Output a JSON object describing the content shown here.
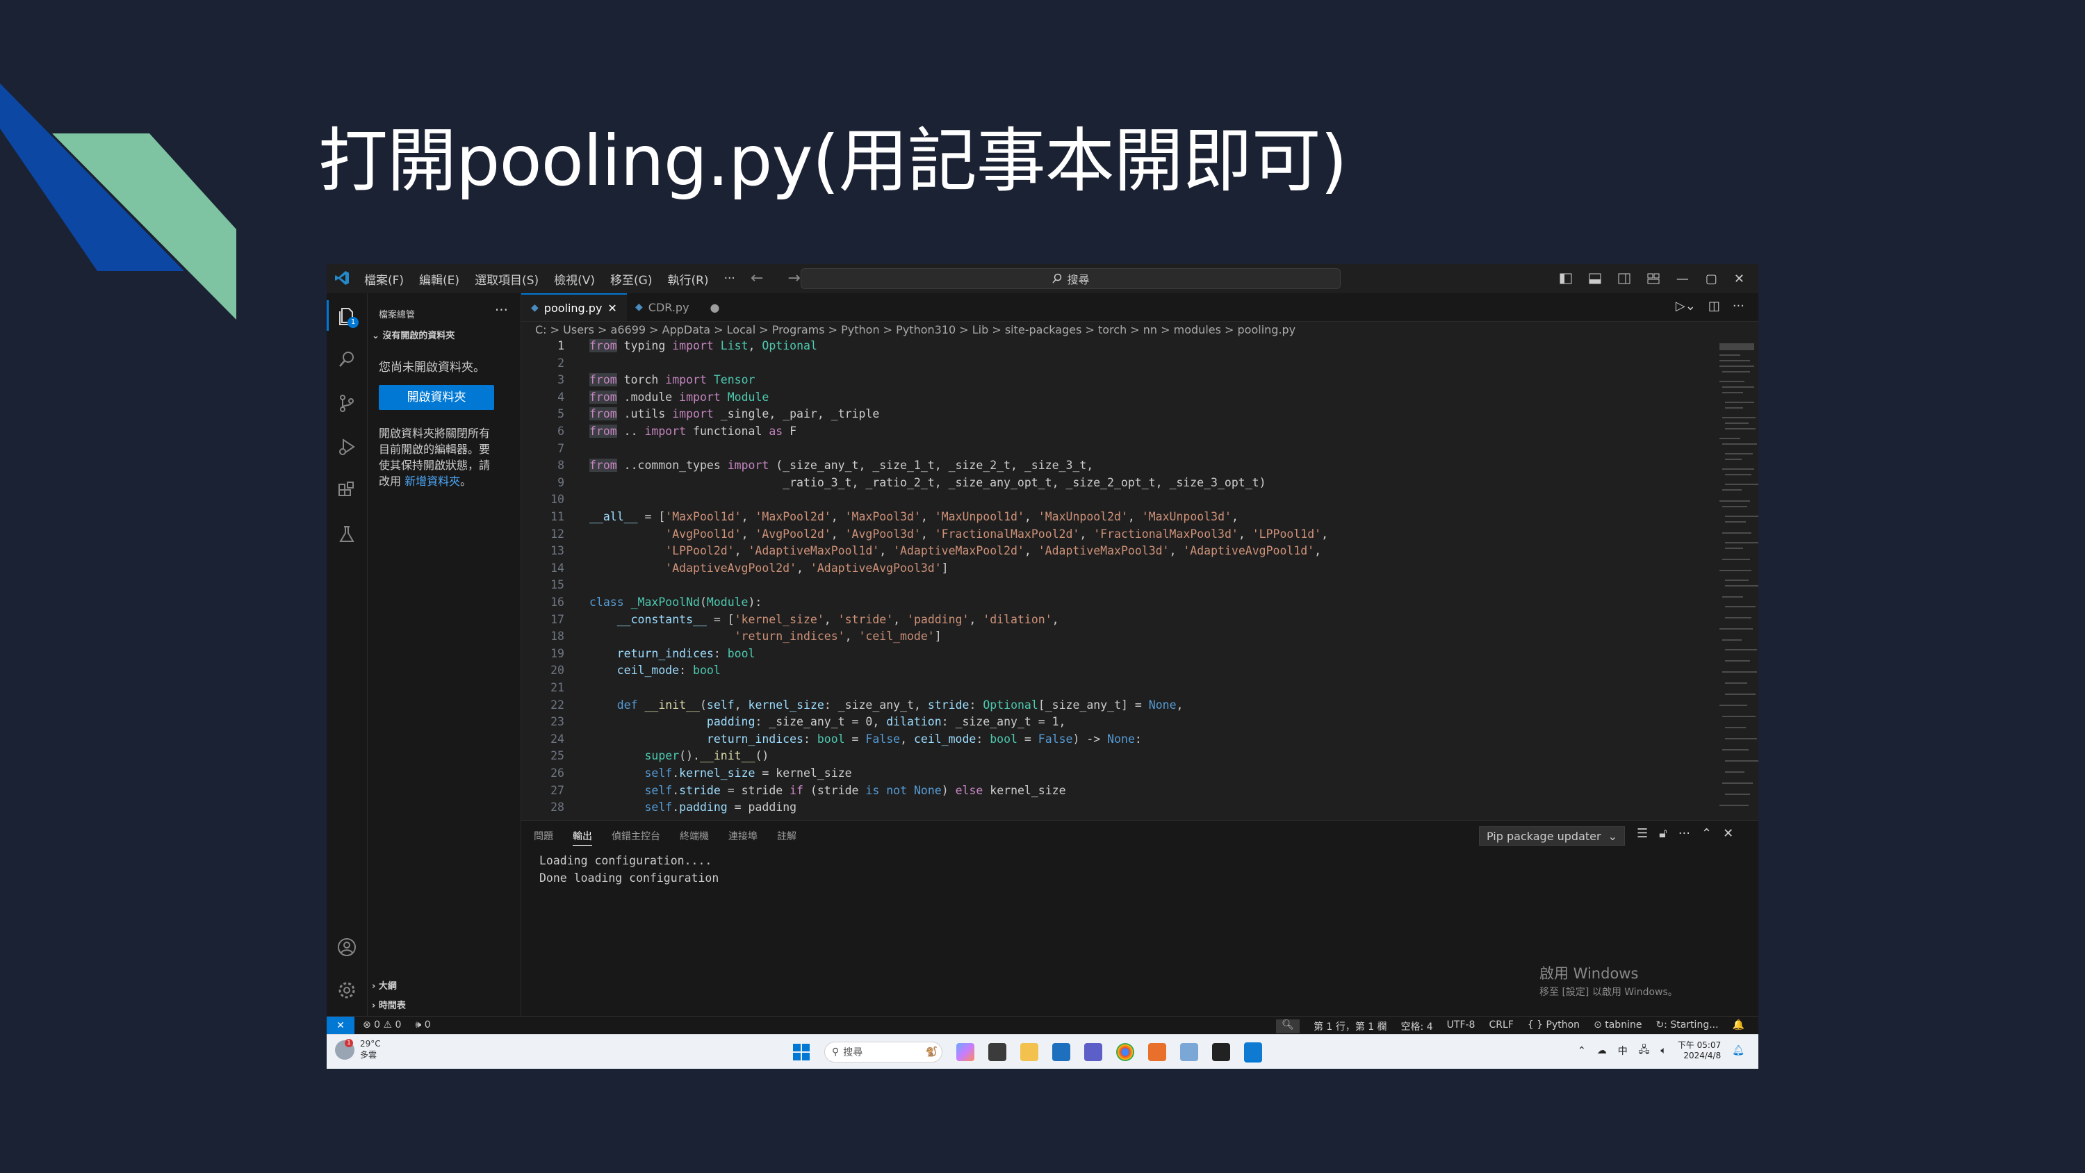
{
  "slide": {
    "title": "打開pooling.py(用記事本開即可)",
    "colors": {
      "background": "#1b2233",
      "deco_blue": "#0c47a3",
      "deco_green": "#7fc4a2"
    }
  },
  "vscode": {
    "menu": [
      "檔案(F)",
      "編輯(E)",
      "選取項目(S)",
      "檢視(V)",
      "移至(G)",
      "執行(R)",
      "···"
    ],
    "nav_arrows": "← →",
    "search_placeholder": "搜尋",
    "window_controls": [
      "—",
      "▢",
      "✕"
    ],
    "sidebar": {
      "title": "檔案總管",
      "more": "···",
      "section": "沒有開啟的資料夾",
      "no_folder_text": "您尚未開啟資料夾。",
      "open_folder_button": "開啟資料夾",
      "paragraph": "開啟資料夾將關閉所有目前開啟的編輯器。要使其保持開啟狀態，請改用",
      "link": "新增資料夾",
      "paragraph_end": "。",
      "bottom_sections": [
        "大綱",
        "時間表"
      ]
    },
    "activity_badge": "1",
    "tabs": [
      {
        "label": "pooling.py",
        "close": "✕"
      },
      {
        "label": "CDR.py",
        "dirty": "●"
      }
    ],
    "breadcrumb": "C: > Users > a6699 > AppData > Local > Programs > Python > Python310 > Lib > site-packages > torch > nn > modules > pooling.py",
    "code_lines": [
      {
        "n": "1",
        "text": "from typing import List, Optional"
      },
      {
        "n": "2",
        "text": ""
      },
      {
        "n": "3",
        "text": "from torch import Tensor"
      },
      {
        "n": "4",
        "text": "from .module import Module"
      },
      {
        "n": "5",
        "text": "from .utils import _single, _pair, _triple"
      },
      {
        "n": "6",
        "text": "from .. import functional as F"
      },
      {
        "n": "7",
        "text": ""
      },
      {
        "n": "8",
        "text": "from ..common_types import (_size_any_t, _size_1_t, _size_2_t, _size_3_t,"
      },
      {
        "n": "9",
        "text": "                            _ratio_3_t, _ratio_2_t, _size_any_opt_t, _size_2_opt_t, _size_3_opt_t)"
      },
      {
        "n": "10",
        "text": ""
      },
      {
        "n": "11",
        "text": "__all__ = ['MaxPool1d', 'MaxPool2d', 'MaxPool3d', 'MaxUnpool1d', 'MaxUnpool2d', 'MaxUnpool3d',"
      },
      {
        "n": "12",
        "text": "           'AvgPool1d', 'AvgPool2d', 'AvgPool3d', 'FractionalMaxPool2d', 'FractionalMaxPool3d', 'LPPool1d',"
      },
      {
        "n": "13",
        "text": "           'LPPool2d', 'AdaptiveMaxPool1d', 'AdaptiveMaxPool2d', 'AdaptiveMaxPool3d', 'AdaptiveAvgPool1d',"
      },
      {
        "n": "14",
        "text": "           'AdaptiveAvgPool2d', 'AdaptiveAvgPool3d']"
      },
      {
        "n": "15",
        "text": ""
      },
      {
        "n": "16",
        "text": "class _MaxPoolNd(Module):"
      },
      {
        "n": "17",
        "text": "    __constants__ = ['kernel_size', 'stride', 'padding', 'dilation',"
      },
      {
        "n": "18",
        "text": "                     'return_indices', 'ceil_mode']"
      },
      {
        "n": "19",
        "text": "    return_indices: bool"
      },
      {
        "n": "20",
        "text": "    ceil_mode: bool"
      },
      {
        "n": "21",
        "text": ""
      },
      {
        "n": "22",
        "text": "    def __init__(self, kernel_size: _size_any_t, stride: Optional[_size_any_t] = None,"
      },
      {
        "n": "23",
        "text": "                 padding: _size_any_t = 0, dilation: _size_any_t = 1,"
      },
      {
        "n": "24",
        "text": "                 return_indices: bool = False, ceil_mode: bool = False) -> None:"
      },
      {
        "n": "25",
        "text": "        super().__init__()"
      },
      {
        "n": "26",
        "text": "        self.kernel_size = kernel_size"
      },
      {
        "n": "27",
        "text": "        self.stride = stride if (stride is not None) else kernel_size"
      },
      {
        "n": "28",
        "text": "        self.padding = padding"
      }
    ],
    "panel": {
      "tabs": [
        "問題",
        "輸出",
        "偵錯主控台",
        "終端機",
        "連接埠",
        "註解"
      ],
      "active_tab": "輸出",
      "select_value": "Pip package updater",
      "output_lines": [
        "Loading configuration....",
        "Done loading configuration"
      ]
    },
    "watermark": {
      "line1": "啟用 Windows",
      "line2": "移至 [設定] 以啟用 Windows。"
    },
    "status": {
      "remote": "✕",
      "errors": "⊗ 0",
      "warnings": "⚠ 0",
      "ports": "🕪 0",
      "position": "第 1 行，第 1 欄",
      "spaces": "空格: 4",
      "encoding": "UTF-8",
      "eol": "CRLF",
      "language": "{ } Python",
      "tabnine": "⊙ tabnine",
      "starting": "↻: Starting...",
      "bell": "🔔"
    }
  },
  "taskbar": {
    "weather_temp": "29°C",
    "weather_desc": "多雲",
    "weather_badge": "1",
    "search_placeholder": "搜尋",
    "ime": "中",
    "time": "下午 05:07",
    "date": "2024/4/8"
  }
}
